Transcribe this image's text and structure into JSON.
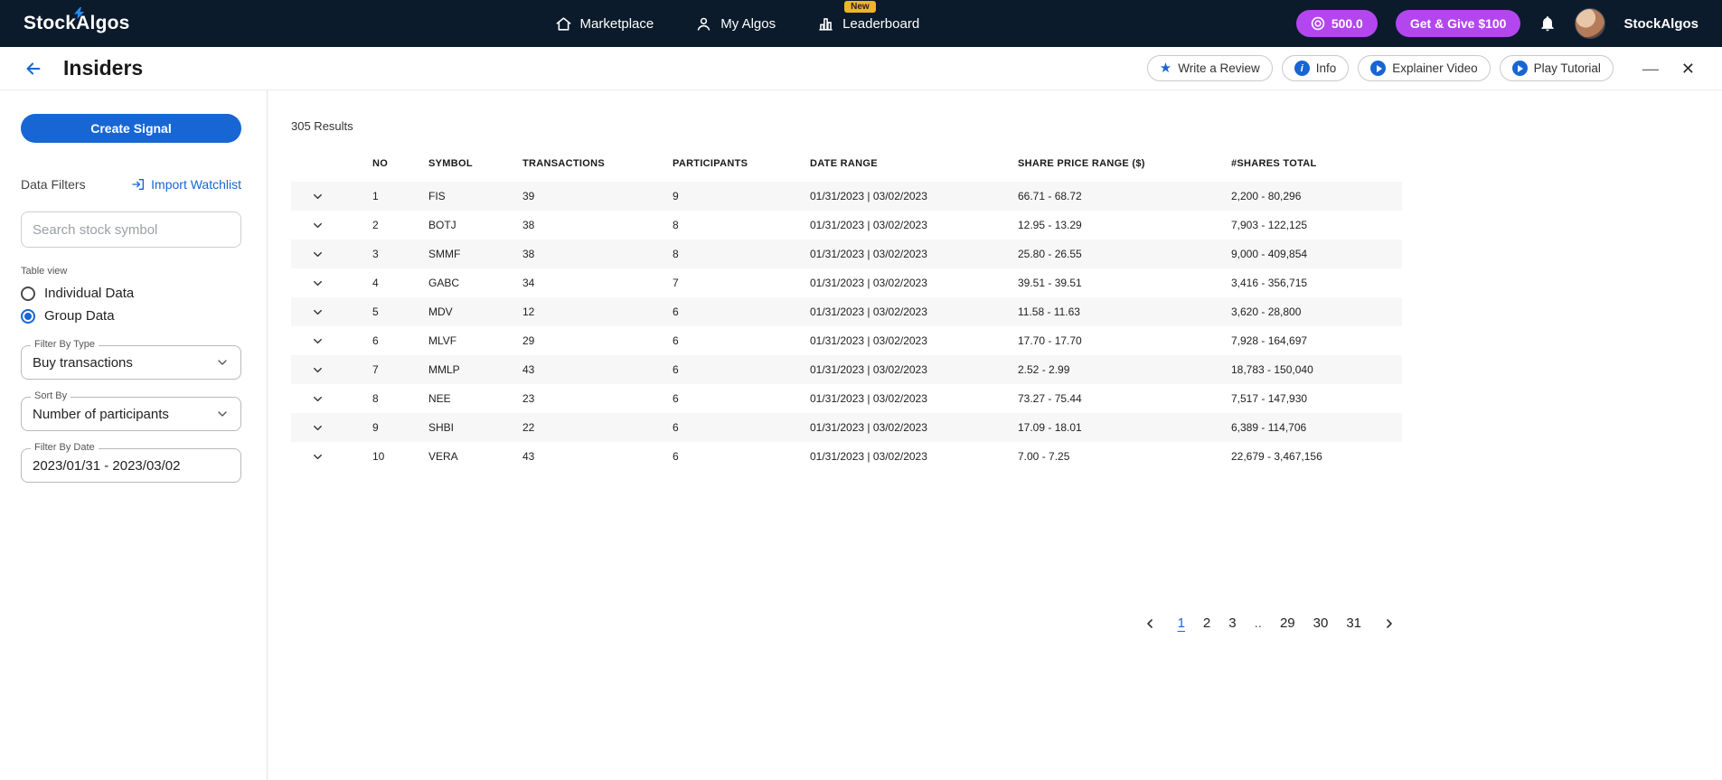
{
  "navbar": {
    "brand": "StockAlgos",
    "items": [
      {
        "label": "Marketplace",
        "icon": "home-icon"
      },
      {
        "label": "My Algos",
        "icon": "person-icon"
      },
      {
        "label": "Leaderboard",
        "icon": "bar-chart-icon",
        "badge": "New"
      }
    ],
    "credits": "500.0",
    "cta_label": "Get & Give $100",
    "user_name": "StockAlgos"
  },
  "header": {
    "title": "Insiders",
    "actions": [
      "Write a Review",
      "Info",
      "Explainer Video",
      "Play Tutorial"
    ]
  },
  "icons": {
    "info_letter": "i",
    "minimize": "—",
    "close": "✕"
  },
  "sidebar": {
    "create_signal_label": "Create Signal",
    "data_filters_label": "Data Filters",
    "import_watchlist_label": "Import Watchlist",
    "search_placeholder": "Search stock symbol",
    "table_view": {
      "label": "Table view",
      "options": [
        {
          "label": "Individual Data",
          "selected": false
        },
        {
          "label": "Group Data",
          "selected": true
        }
      ]
    },
    "filter_by_type": {
      "label": "Filter By Type",
      "value": "Buy transactions"
    },
    "sort_by": {
      "label": "Sort By",
      "value": "Number of participants"
    },
    "filter_by_date": {
      "label": "Filter By Date",
      "value": "2023/01/31 - 2023/03/02"
    }
  },
  "results": {
    "count_label": "305 Results",
    "columns": [
      "NO",
      "SYMBOL",
      "TRANSACTIONS",
      "PARTICIPANTS",
      "DATE RANGE",
      "SHARE PRICE RANGE ($)",
      "#SHARES TOTAL"
    ],
    "rows": [
      [
        "1",
        "FIS",
        "39",
        "9",
        "01/31/2023 | 03/02/2023",
        "66.71 - 68.72",
        "2,200 - 80,296"
      ],
      [
        "2",
        "BOTJ",
        "38",
        "8",
        "01/31/2023 | 03/02/2023",
        "12.95 - 13.29",
        "7,903 - 122,125"
      ],
      [
        "3",
        "SMMF",
        "38",
        "8",
        "01/31/2023 | 03/02/2023",
        "25.80 - 26.55",
        "9,000 - 409,854"
      ],
      [
        "4",
        "GABC",
        "34",
        "7",
        "01/31/2023 | 03/02/2023",
        "39.51 - 39.51",
        "3,416 - 356,715"
      ],
      [
        "5",
        "MDV",
        "12",
        "6",
        "01/31/2023 | 03/02/2023",
        "11.58 - 11.63",
        "3,620 - 28,800"
      ],
      [
        "6",
        "MLVF",
        "29",
        "6",
        "01/31/2023 | 03/02/2023",
        "17.70 - 17.70",
        "7,928 - 164,697"
      ],
      [
        "7",
        "MMLP",
        "43",
        "6",
        "01/31/2023 | 03/02/2023",
        "2.52 - 2.99",
        "18,783 - 150,040"
      ],
      [
        "8",
        "NEE",
        "23",
        "6",
        "01/31/2023 | 03/02/2023",
        "73.27 - 75.44",
        "7,517 - 147,930"
      ],
      [
        "9",
        "SHBI",
        "22",
        "6",
        "01/31/2023 | 03/02/2023",
        "17.09 - 18.01",
        "6,389 - 114,706"
      ],
      [
        "10",
        "VERA",
        "43",
        "6",
        "01/31/2023 | 03/02/2023",
        "7.00 - 7.25",
        "22,679 - 3,467,156"
      ]
    ]
  },
  "pagination": {
    "pages": [
      "1",
      "2",
      "3",
      "..",
      "29",
      "30",
      "31"
    ],
    "current_index": 0
  }
}
